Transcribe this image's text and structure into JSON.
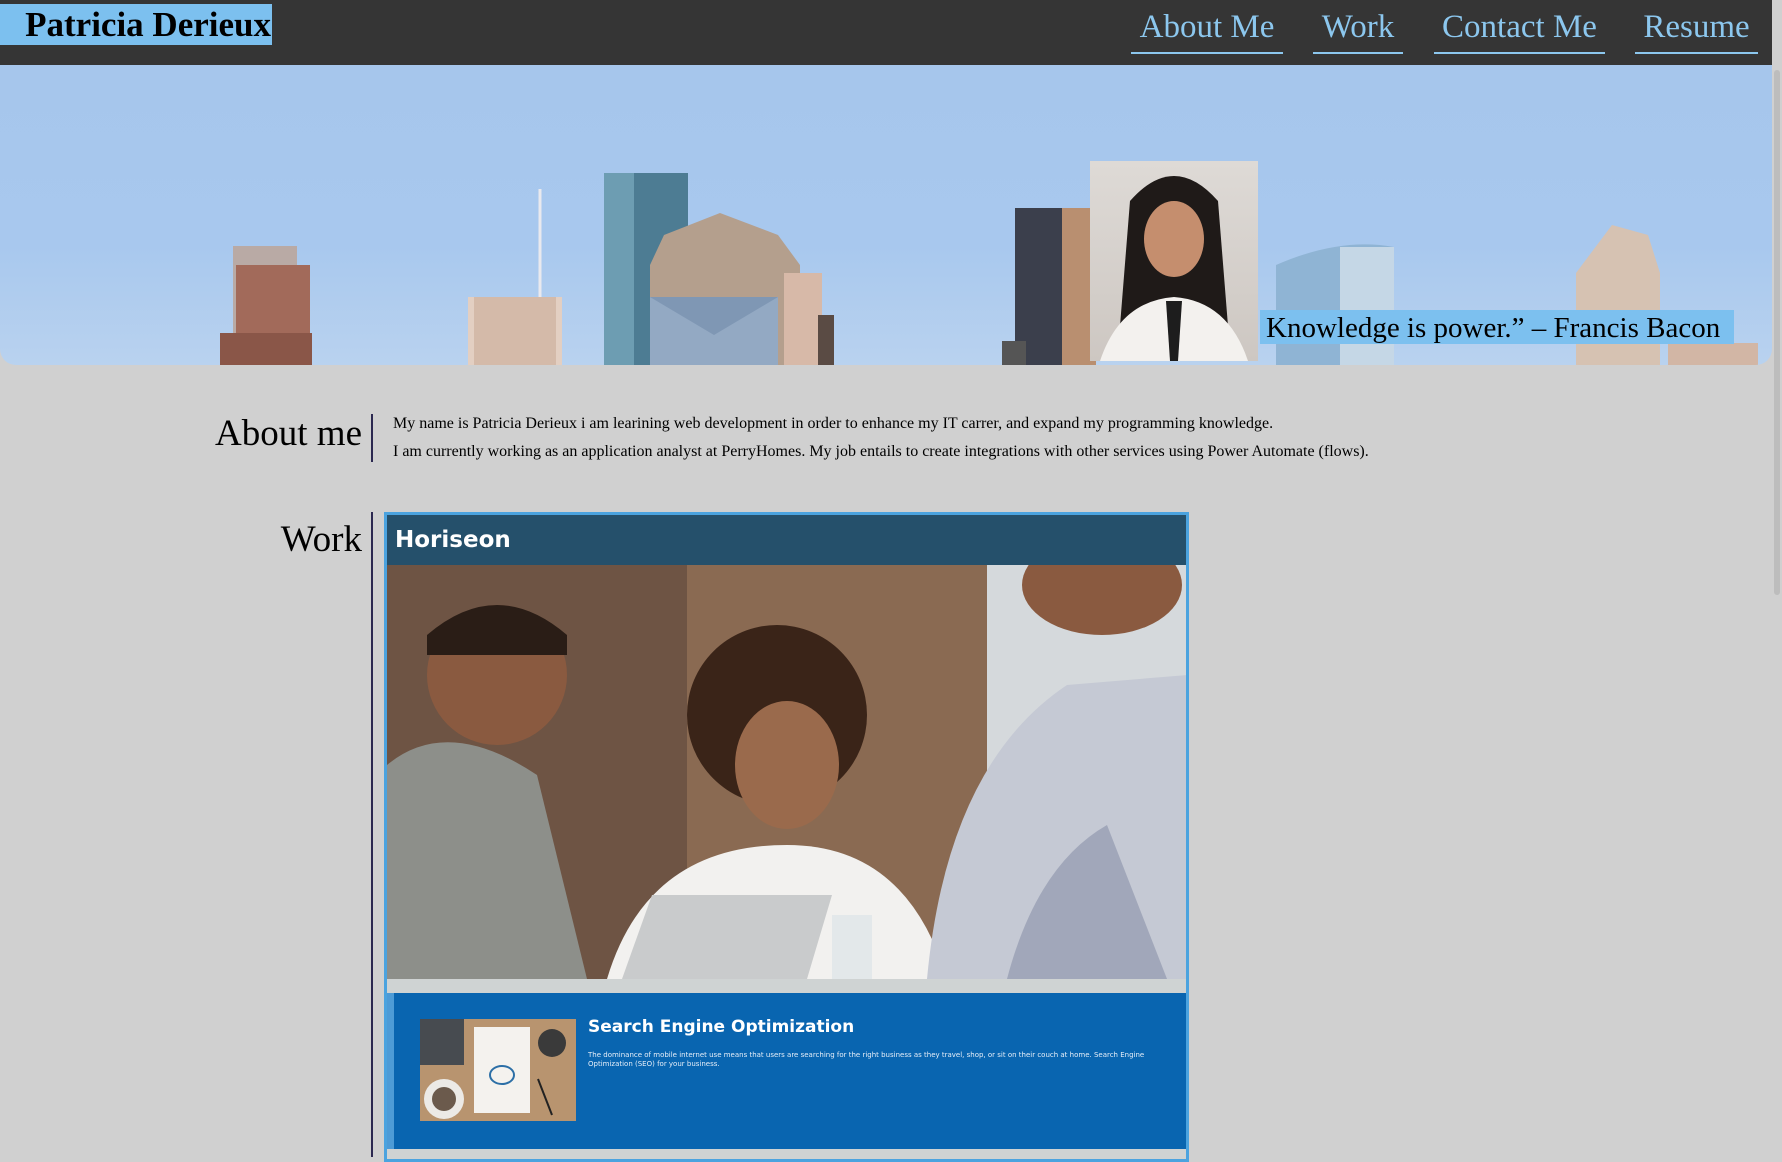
{
  "header": {
    "brand": "Patricia Derieux",
    "nav": [
      "About Me",
      "Work",
      "Contact Me",
      "Resume"
    ]
  },
  "hero": {
    "quote": "Knowledge is power.” – Francis Bacon"
  },
  "about": {
    "title": "About me",
    "lines": [
      "My name is Patricia Derieux i am learining web development in order to enhance my IT carrer, and expand my programming knowledge.",
      "I am currently working as an application analyst at PerryHomes. My job entails to create integrations with other services using Power Automate (flows)."
    ]
  },
  "work": {
    "title": "Work",
    "project": {
      "site_name": "Horiseon",
      "seo_title": "Search Engine Optimization",
      "seo_text": "The dominance of mobile internet use means that users are searching for the right business as they travel, shop, or sit on their couch at home. Search Engine Optimization (SEO) for your business."
    }
  },
  "colors": {
    "header_bg": "#353535",
    "accent": "#7cc0ef",
    "nav_text": "#8cc7ee",
    "page_bg": "#d0d0d0",
    "card_header": "#25506b",
    "seo_bg": "#0965b0"
  }
}
